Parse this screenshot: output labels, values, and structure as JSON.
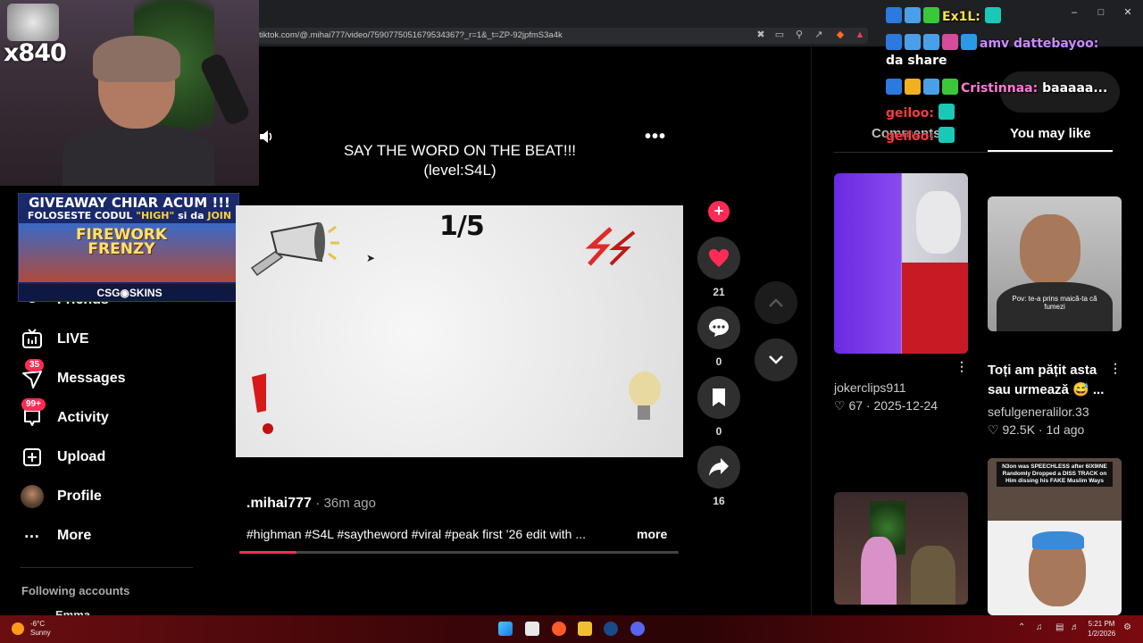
{
  "browser": {
    "url": "tiktok.com/@.mihai777/video/7590775051679534367?_r=1&_t=ZP-92jpfmS3a4k"
  },
  "webcam": {
    "count_text": "x840"
  },
  "giveaway": {
    "line1": "GIVEAWAY CHIAR ACUM !!!",
    "line2_pre": "FOLOSESTE CODUL ",
    "line2_code": "\"HIGH\"",
    "line2_mid": " si da ",
    "line2_join": "JOIN",
    "game": "FIREWORK FRENZY",
    "brand": "CSG◉SKINS"
  },
  "sidebar": {
    "items": [
      {
        "label": "Friends"
      },
      {
        "label": "LIVE"
      },
      {
        "label": "Messages",
        "badge": "35"
      },
      {
        "label": "Activity",
        "badge": "99+"
      },
      {
        "label": "Upload"
      },
      {
        "label": "Profile"
      },
      {
        "label": "More"
      }
    ],
    "following_header": "Following accounts",
    "following_first": "Emma"
  },
  "video": {
    "title_line1": "SAY THE WORD ON THE BEAT!!!",
    "title_line2": "(level:S4L)",
    "counter": "1/5",
    "author": ".mihai777",
    "time": "36m ago",
    "description": "#highman #S4L #saytheword #viral #peak first ’26 edit with ...",
    "more": "more",
    "progress": 0.13
  },
  "actions": {
    "likes": "21",
    "comments": "0",
    "saves": "0",
    "shares": "16"
  },
  "right_panel": {
    "tabs": [
      "Comments",
      "You may like"
    ],
    "active_tab": "You may like",
    "cards": [
      {
        "author": "jokerclips911",
        "likes": "67",
        "date": "2025-12-24"
      },
      {
        "title": "Toți am pățit asta sau urmează 😅 ...",
        "author": "sefulgeneralilor.33",
        "likes": "92.5K",
        "date": "1d ago",
        "thumb_caption": "Pov: te-a prins maică-ta că fumezi"
      },
      {},
      {
        "thumb_caption": "N3on was SPEECHLESS after 6IX9INE Randomly Dropped a DISS TRACK on Him dissing his FAKE Muslim Ways"
      }
    ]
  },
  "chat": [
    {
      "user": "Ex1L:",
      "message": "",
      "color": "#ffe14a"
    },
    {
      "user": "amv dattebayoo:",
      "message": "da share",
      "color": "#c88bff"
    },
    {
      "user": "Cristinnaa:",
      "message": "baaaaa...",
      "color": "#ff7ad9"
    },
    {
      "user": "geiloo:",
      "message": "",
      "color": "#ff3a3a"
    },
    {
      "user": "geiloo:",
      "message": "",
      "color": "#ff3a3a"
    }
  ],
  "taskbar": {
    "temp": "-6°C",
    "weather": "Sunny",
    "time": "5:21 PM",
    "date": "1/2/2026"
  },
  "colors": {
    "accent": "#fe2c55",
    "bg": "#000000"
  }
}
